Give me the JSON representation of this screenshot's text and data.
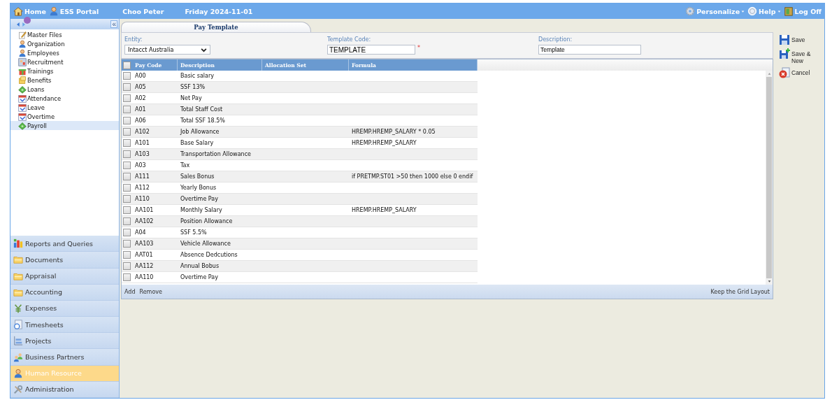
{
  "top_bar": {
    "left_links": [
      {
        "label": "Home"
      },
      {
        "label": "ESS Portal"
      }
    ],
    "user": "Choo Peter",
    "date": "Friday 2024-11-01",
    "right_links": [
      {
        "label": "Personalize",
        "dropdown": true
      },
      {
        "label": "Help",
        "dropdown": true
      },
      {
        "label": "Log Off",
        "dropdown": false
      }
    ]
  },
  "sidebar": {
    "collapse_glyph": "«",
    "tree": [
      {
        "label": "Master Files",
        "selected": false
      },
      {
        "label": "Organization",
        "selected": false
      },
      {
        "label": "Employees",
        "selected": false
      },
      {
        "label": "Recruitment",
        "selected": false
      },
      {
        "label": "Trainings",
        "selected": false
      },
      {
        "label": "Benefits",
        "selected": false
      },
      {
        "label": "Loans",
        "selected": false
      },
      {
        "label": "Attendance",
        "selected": false
      },
      {
        "label": "Leave",
        "selected": false
      },
      {
        "label": "Overtime",
        "selected": false
      },
      {
        "label": "Payroll",
        "selected": true
      }
    ],
    "modules": [
      {
        "label": "Reports and Queries",
        "selected": false
      },
      {
        "label": "Documents",
        "selected": false
      },
      {
        "label": "Appraisal",
        "selected": false
      },
      {
        "label": "Accounting",
        "selected": false
      },
      {
        "label": "Expenses",
        "selected": false
      },
      {
        "label": "Timesheets",
        "selected": false
      },
      {
        "label": "Projects",
        "selected": false
      },
      {
        "label": "Business Partners",
        "selected": false
      },
      {
        "label": "Human Resource",
        "selected": true
      },
      {
        "label": "Administration",
        "selected": false
      }
    ]
  },
  "tabs": [
    {
      "label": "Pay Template",
      "selected": true
    }
  ],
  "form": {
    "entity": {
      "label": "Entity:",
      "value": "Intacct Australia"
    },
    "template_code": {
      "label": "Template Code:",
      "value": "TEMPLATE",
      "required_mark": "*"
    },
    "description": {
      "label": "Description:",
      "value": "Template"
    }
  },
  "table": {
    "select_all_checked": false,
    "columns": [
      "Pay Code",
      "Description",
      "Allocation Set",
      "Formula"
    ],
    "rows": [
      {
        "checked": false,
        "cells": [
          "A00",
          "Basic salary",
          "",
          ""
        ]
      },
      {
        "checked": false,
        "cells": [
          "A05",
          "SSF 13%",
          "",
          ""
        ]
      },
      {
        "checked": false,
        "cells": [
          "A02",
          "Net Pay",
          "",
          ""
        ]
      },
      {
        "checked": false,
        "cells": [
          "A01",
          "Total Staff Cost",
          "",
          ""
        ]
      },
      {
        "checked": false,
        "cells": [
          "A06",
          "Total SSF 18.5%",
          "",
          ""
        ]
      },
      {
        "checked": false,
        "cells": [
          "A102",
          "Job Allowance",
          "",
          "HREMP.HREMP_SALARY * 0.05"
        ]
      },
      {
        "checked": false,
        "cells": [
          "A101",
          "Base Salary",
          "",
          "HREMP.HREMP_SALARY"
        ]
      },
      {
        "checked": false,
        "cells": [
          "A103",
          "Transportation Allowance",
          "",
          ""
        ]
      },
      {
        "checked": false,
        "cells": [
          "A03",
          "Tax",
          "",
          ""
        ]
      },
      {
        "checked": false,
        "cells": [
          "A111",
          "Sales Bonus",
          "",
          "if PRETMP.ST01 >50 then 1000 else 0 endif"
        ]
      },
      {
        "checked": false,
        "cells": [
          "A112",
          "Yearly Bonus",
          "",
          ""
        ]
      },
      {
        "checked": false,
        "cells": [
          "A110",
          "Overtime Pay",
          "",
          ""
        ]
      },
      {
        "checked": false,
        "cells": [
          "AA101",
          "Monthly Salary",
          "",
          "HREMP.HREMP_SALARY"
        ]
      },
      {
        "checked": false,
        "cells": [
          "AA102",
          "Position Allowance",
          "",
          ""
        ]
      },
      {
        "checked": false,
        "cells": [
          "A04",
          "SSF 5.5%",
          "",
          ""
        ]
      },
      {
        "checked": false,
        "cells": [
          "AA103",
          "Vehicle Allowance",
          "",
          ""
        ]
      },
      {
        "checked": false,
        "cells": [
          "AAT01",
          "Absence Dedcutions",
          "",
          ""
        ]
      },
      {
        "checked": false,
        "cells": [
          "AA112",
          "Annual Bobus",
          "",
          ""
        ]
      },
      {
        "checked": false,
        "cells": [
          "AA110",
          "Overtime Pay",
          "",
          ""
        ]
      }
    ],
    "footer_actions": [
      "Add",
      "Remove"
    ],
    "footer_right": "Keep the Grid Layout"
  },
  "toolbar": [
    {
      "kind": "save",
      "label": "Save"
    },
    {
      "kind": "save_new",
      "label": "Save & New"
    },
    {
      "kind": "cancel",
      "label": "Cancel"
    }
  ]
}
